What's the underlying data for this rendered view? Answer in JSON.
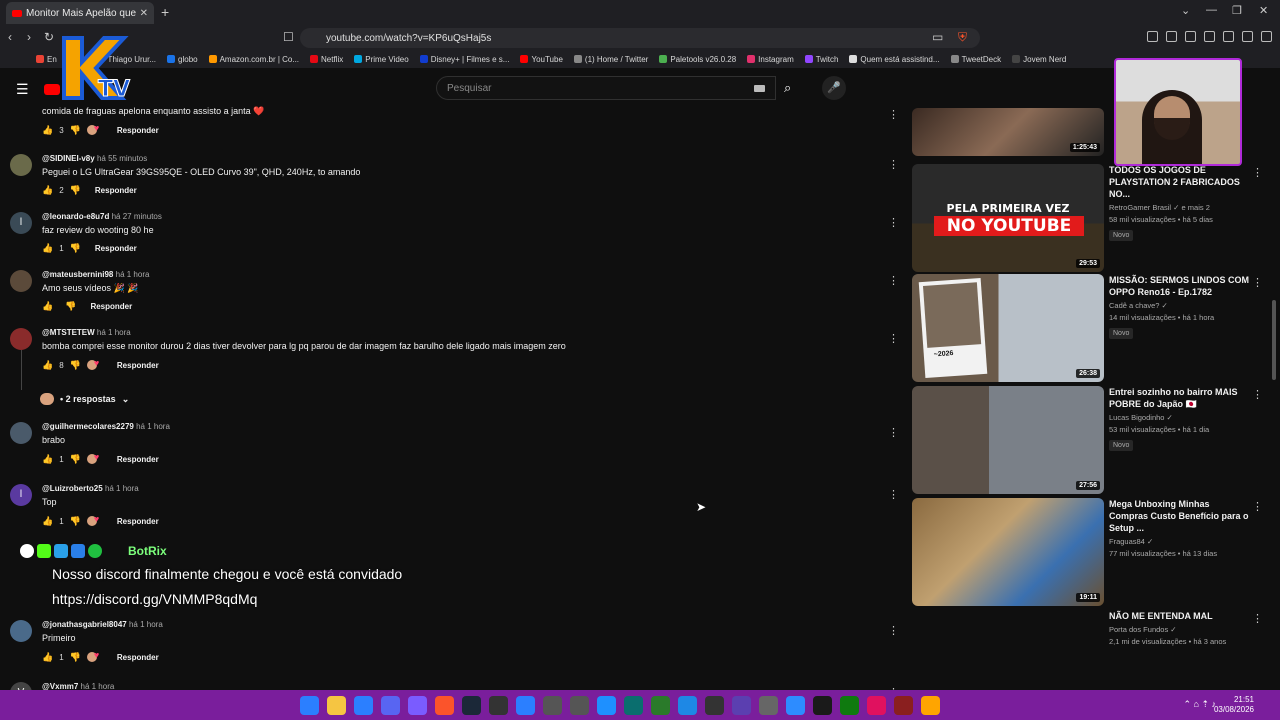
{
  "browser": {
    "tab_title": "Monitor Mais Apelão que Dá",
    "url": "youtube.com/watch?v=KP6uQsHaj5s",
    "bookmarks": [
      "En",
      "Email – Thiago Urur...",
      "globo",
      "Amazon.com.br | Co...",
      "Netflix",
      "Prime Video",
      "Disney+ | Filmes e s...",
      "YouTube",
      "(1) Home / Twitter",
      "Paletools v26.0.28",
      "Instagram",
      "Twitch",
      "Quem está assistind...",
      "TweetDeck",
      "Jovem Nerd"
    ]
  },
  "youtube": {
    "search_placeholder": "Pesquisar"
  },
  "comments": [
    {
      "user": "",
      "time": "",
      "text": "comida de fraguas apelona enquanto assisto a janta ❤️",
      "likes": "3",
      "reply": "Responder"
    },
    {
      "user": "@SIDINEI-v8y",
      "time": "há 55 minutos",
      "text": "Peguei o LG UltraGear 39GS95QE - OLED Curvo 39\", QHD, 240Hz, to amando",
      "likes": "2",
      "reply": "Responder"
    },
    {
      "user": "@leonardo-e8u7d",
      "time": "há 27 minutos",
      "text": "faz review do wooting 80 he",
      "likes": "1",
      "reply": "Responder"
    },
    {
      "user": "@mateusbernini98",
      "time": "há 1 hora",
      "text": "Amo seus vídeos 🎉 🎉",
      "likes": "",
      "reply": "Responder"
    },
    {
      "user": "@MTSTETEW",
      "time": "há 1 hora",
      "text": "bomba comprei esse monitor durou 2 dias tiver devolver para lg pq parou de dar imagem faz barulho dele ligado mais imagem zero",
      "likes": "8",
      "reply": "Responder"
    },
    {
      "user": "@guilhermecolares2279",
      "time": "há 1 hora",
      "text": "brabo",
      "likes": "1",
      "reply": "Responder"
    },
    {
      "user": "@Luizroberto25",
      "time": "há 1 hora",
      "text": "Top",
      "likes": "1",
      "reply": "Responder"
    },
    {
      "user": "@jonathasgabriel8047",
      "time": "há 1 hora",
      "text": "Primeiro",
      "likes": "1",
      "reply": "Responder"
    },
    {
      "user": "@Vxmm7",
      "time": "há 1 hora",
      "text": "",
      "likes": "",
      "reply": ""
    }
  ],
  "replies_toggle": "• 2 respostas",
  "botrix": {
    "name": "BotRix",
    "message": "Nosso discord finalmente chegou e você está convidado",
    "link": "https://discord.gg/VNMMP8qdMq"
  },
  "related": [
    {
      "title": "",
      "channel": "",
      "stats": "",
      "duration": "1:25:43",
      "badge": ""
    },
    {
      "title": "TODOS OS JOGOS DE PLAYSTATION 2 FABRICADOS NO...",
      "channel": "RetroGamer Brasil ✓ e mais 2",
      "stats": "58 mil visualizações • há 5 dias",
      "duration": "29:53",
      "badge": "Novo"
    },
    {
      "title": "MISSÃO: SERMOS LINDOS COM OPPO Reno16 - Ep.1782",
      "channel": "Cadê a chave? ✓",
      "stats": "14 mil visualizações • há 1 hora",
      "duration": "26:38",
      "badge": "Novo"
    },
    {
      "title": "Entrei sozinho no bairro MAIS POBRE do Japão 🇯🇵",
      "channel": "Lucas Bigodinho ✓",
      "stats": "53 mil visualizações • há 1 dia",
      "duration": "27:56",
      "badge": "Novo"
    },
    {
      "title": "Mega Unboxing Minhas Compras Custo Benefício para o Setup ...",
      "channel": "Fraguas84 ✓",
      "stats": "77 mil visualizações • há 13 dias",
      "duration": "19:11",
      "badge": ""
    },
    {
      "title": "NÃO ME ENTENDA MAL",
      "channel": "Porta dos Fundos ✓",
      "stats": "2,1 mi de visualizações • há 3 anos",
      "duration": "",
      "badge": ""
    }
  ],
  "thumb_text": {
    "line1": "PELA PRIMEIRA VEZ",
    "line2": "NO YOUTUBE",
    "sign": "~2026"
  },
  "taskbar": {
    "time": "21:51",
    "date": "03/08/2026"
  }
}
